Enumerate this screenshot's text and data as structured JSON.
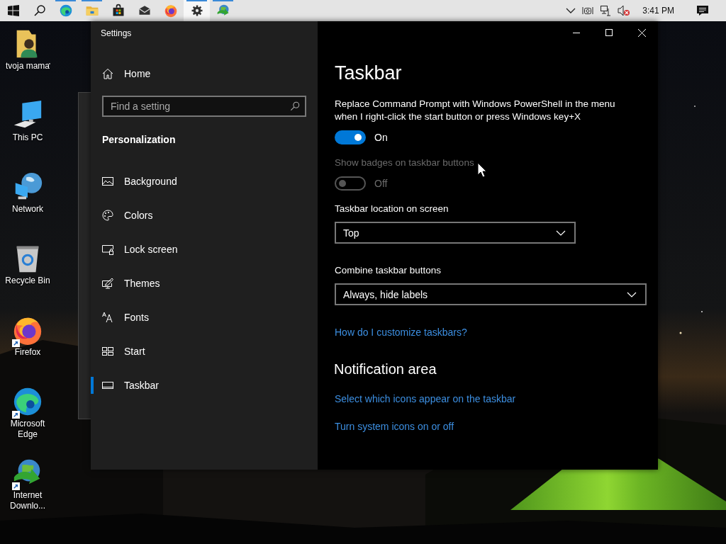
{
  "taskbar": {
    "apps": [
      {
        "kind": "edge",
        "running": true,
        "selected": false
      },
      {
        "kind": "folder",
        "running": true,
        "selected": false
      },
      {
        "kind": "store",
        "running": false,
        "selected": false
      },
      {
        "kind": "mail",
        "running": false,
        "selected": false
      },
      {
        "kind": "firefox",
        "running": false,
        "selected": false
      },
      {
        "kind": "settings",
        "running": true,
        "selected": true
      },
      {
        "kind": "idm",
        "running": true,
        "selected": false
      }
    ],
    "clock": "3:41 PM"
  },
  "desktop_icons": [
    {
      "label": "tvoja mama",
      "kind": "user-folder",
      "shortcut": false
    },
    {
      "label": "This PC",
      "kind": "computer",
      "shortcut": false
    },
    {
      "label": "Network",
      "kind": "network",
      "shortcut": false
    },
    {
      "label": "Recycle Bin",
      "kind": "recycle-bin",
      "shortcut": false
    },
    {
      "label": "Firefox",
      "kind": "firefox",
      "shortcut": true
    },
    {
      "label": "Microsoft Edge",
      "kind": "edge",
      "shortcut": true
    },
    {
      "label": "Internet Downlo...",
      "kind": "idm",
      "shortcut": true
    }
  ],
  "window": {
    "title": "Settings",
    "sidebar": {
      "home": "Home",
      "search": {
        "placeholder": "Find a setting"
      },
      "section": "Personalization",
      "items": [
        {
          "label": "Background",
          "kind": "background",
          "selected": false
        },
        {
          "label": "Colors",
          "kind": "colors",
          "selected": false
        },
        {
          "label": "Lock screen",
          "kind": "lock",
          "selected": false
        },
        {
          "label": "Themes",
          "kind": "themes",
          "selected": false
        },
        {
          "label": "Fonts",
          "kind": "fonts",
          "selected": false
        },
        {
          "label": "Start",
          "kind": "start",
          "selected": false
        },
        {
          "label": "Taskbar",
          "kind": "taskbar",
          "selected": true
        }
      ]
    },
    "content": {
      "title": "Taskbar",
      "items": [
        {
          "kind": "toggle",
          "label": "Replace Command Prompt with Windows PowerShell in the menu when I right-click the start button or press Windows key+X",
          "on": true,
          "disabled": false,
          "state_text": "On"
        },
        {
          "kind": "toggle",
          "label": "Show badges on taskbar buttons",
          "on": false,
          "disabled": true,
          "state_text": "Off"
        },
        {
          "kind": "dropdown",
          "label": "Taskbar location on screen",
          "value": "Top"
        },
        {
          "kind": "dropdown",
          "label": "Combine taskbar buttons",
          "value": "Always, hide labels"
        },
        {
          "kind": "link",
          "text": "How do I customize taskbars?"
        }
      ],
      "sections": [
        {
          "title": "Notification area",
          "items": [
            {
              "kind": "link",
              "text": "Select which icons appear on the taskbar"
            },
            {
              "kind": "link",
              "text": "Turn system icons on or off"
            }
          ]
        }
      ]
    }
  }
}
